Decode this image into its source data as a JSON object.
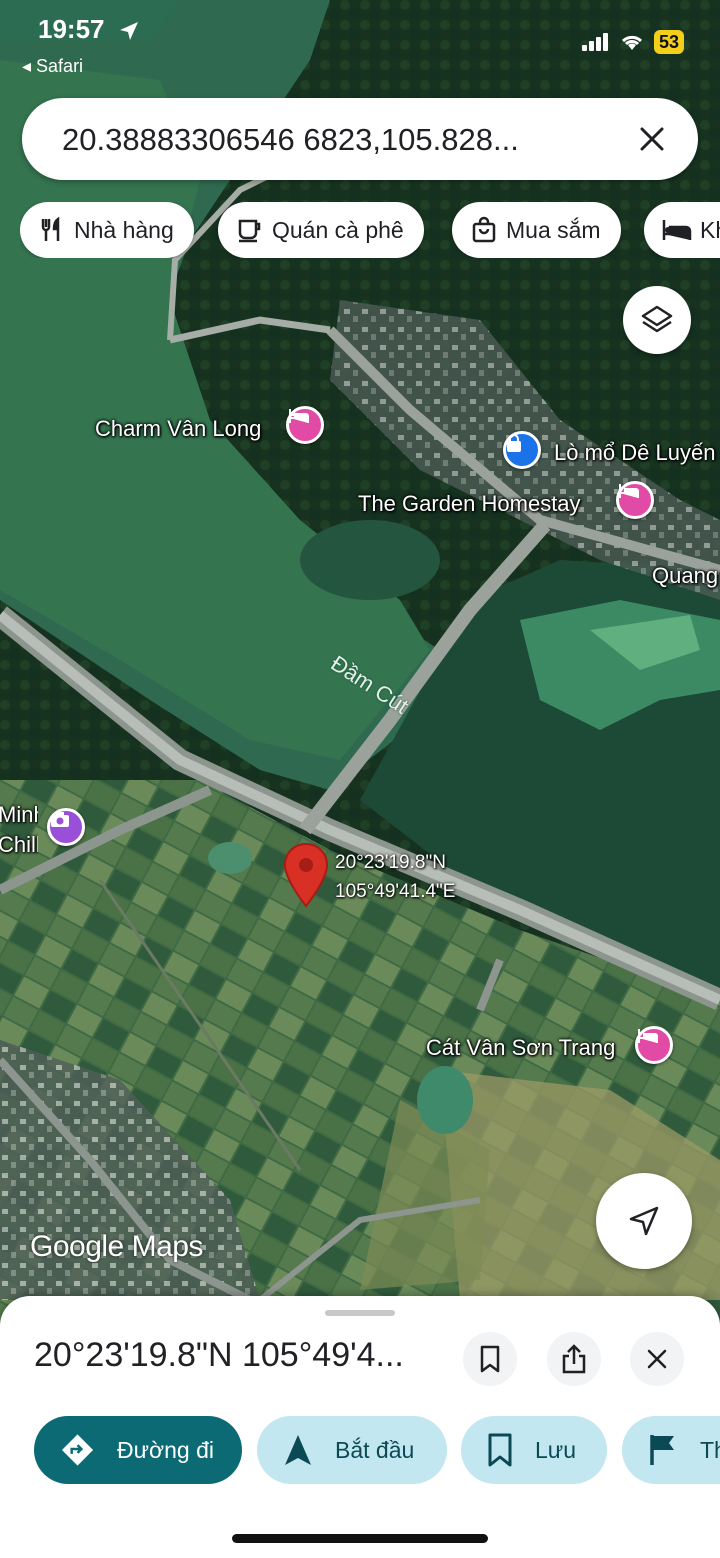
{
  "status": {
    "time": "19:57",
    "back_label": "◂ Safari",
    "battery": "53"
  },
  "search": {
    "query": "20.38883306546 6823,105.828..."
  },
  "categories": [
    {
      "label": "Nhà hàng",
      "icon": "fork-knife-icon"
    },
    {
      "label": "Quán cà phê",
      "icon": "coffee-cup-icon"
    },
    {
      "label": "Mua sắm",
      "icon": "shopping-bag-icon"
    },
    {
      "label": "Kh",
      "icon": "bed-icon"
    }
  ],
  "map": {
    "places": [
      {
        "name": "Charm Vân Long",
        "type": "hotel"
      },
      {
        "name": "Lò mổ Dê Luyến",
        "type": "shop"
      },
      {
        "name": "The Garden Homestay",
        "type": "hotel"
      },
      {
        "name": "Quang",
        "type": "label"
      },
      {
        "name": "Đầm Cút",
        "type": "water"
      },
      {
        "name": "Minh Chill",
        "type": "attraction"
      },
      {
        "name": "Cát Vân Sơn Trang",
        "type": "hotel"
      }
    ],
    "pin": {
      "lat_label": "20°23'19.8\"N",
      "lng_label": "105°49'41.4\"E"
    },
    "brand": "Google Maps"
  },
  "sheet": {
    "title": "20°23'19.8\"N 105°49'4...",
    "actions": [
      {
        "label": "Đường đi",
        "icon": "directions-icon"
      },
      {
        "label": "Bắt đầu",
        "icon": "navigation-arrow-icon"
      },
      {
        "label": "Lưu",
        "icon": "bookmark-icon"
      },
      {
        "label": "Th",
        "icon": "flag-icon"
      }
    ]
  },
  "colors": {
    "hotel_pin": "#e14ba6",
    "attraction_pin": "#9a4fd8",
    "shop_pin": "#1a73e8",
    "primary_action": "#0b6a74",
    "secondary_action": "#c2e7f0",
    "location_pin": "#d93025"
  }
}
